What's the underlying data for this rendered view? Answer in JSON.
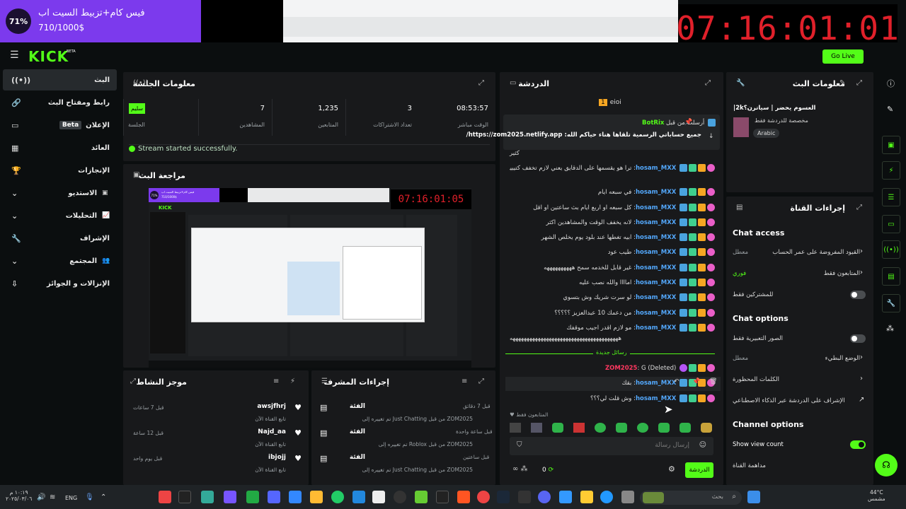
{
  "overlay": {
    "percent": "71%",
    "title": "فيس كام+تزبيط السيت اب",
    "progress": "710/1000$",
    "progress_fraction": 0.71
  },
  "clock": "07:16:01:01",
  "header": {
    "logo": "KICK",
    "logo_badge": "BETA",
    "go_live": "Go Live"
  },
  "sidebar": {
    "items": [
      {
        "label": "البث",
        "active": true
      },
      {
        "label": "رابط ومفتاح البث"
      },
      {
        "label": "الإعلان",
        "badge": "Beta"
      },
      {
        "label": "العائد"
      },
      {
        "label": "الإنجازات"
      },
      {
        "label": "الاستديو"
      },
      {
        "label": "التحليلات"
      },
      {
        "label": "الإشراف"
      },
      {
        "label": "المجتمع"
      },
      {
        "label": "الإنزالات و الجوائز"
      }
    ]
  },
  "session": {
    "title": "معلومات الجلسة",
    "stats": [
      {
        "value": "08:53:57",
        "label": "الوقت مباشر"
      },
      {
        "value": "3",
        "label": "تعداد الاشتراكات"
      },
      {
        "value": "1,235",
        "label": "المتابعين"
      },
      {
        "value": "7",
        "label": "المشاهدين"
      }
    ],
    "health_badge": "سليم",
    "health_label": "الجلسة",
    "status": "Stream started successfully."
  },
  "preview": {
    "title": "مراجعة البث",
    "clock": "07:16:01:05",
    "overlay_pct": "71%",
    "overlay_title": "فيس كام+تزبيط السيت اب",
    "overlay_progress": "710/1000$"
  },
  "activity": {
    "title": "موجز النشاط",
    "items": [
      {
        "name": "awsjfhrj",
        "desc": "تابع القناة الآن",
        "time": "قبل 7 ساعات"
      },
      {
        "name": "Najd_aa",
        "desc": "تابع القناة الآن",
        "time": "قبل 12 ساعة"
      },
      {
        "name": "ibjojj",
        "desc": "تابع القناة الآن",
        "time": "قبل يوم واحد"
      }
    ]
  },
  "mod": {
    "title": "إجراءات المشرف",
    "items": [
      {
        "name": "الفئة",
        "desc": "تم تغييره إلى Just Chatting من قبل ZOM2025",
        "time": "قبل 7 دقائق"
      },
      {
        "name": "الفئة",
        "desc": "تم تغييره إلى Roblox من قبل ZOM2025",
        "time": "قبل ساعة واحدة"
      },
      {
        "name": "الفئة",
        "desc": "تم تغييره إلى Just Chatting من قبل ZOM2025",
        "time": "قبل ساعتين"
      }
    ]
  },
  "chat": {
    "title": "الدردشة",
    "top_user": "eioi",
    "top_rank": "1",
    "pinned_by": "أرسلت من قبل",
    "pinned_user": "BotRix",
    "pinned_text": "جميع حساباتي الرسمية تلقاها هناء حياكم الله: https://zom2025.netlify.app/",
    "partial": "كثير",
    "messages": [
      {
        "user": "hosam_MXX",
        "text": "ترا هو يقسمها على الدقايق يعني لازم تخفف كتيييير الساعات"
      },
      {
        "user": "hosam_MXX",
        "text": "في سبعه ايام"
      },
      {
        "user": "hosam_MXX",
        "text": "كل سبعه او اربع ايام بث ساعتين او اقل"
      },
      {
        "user": "hosam_MXX",
        "text": "لانه يخفف الوقت والمشاهدين اكثر"
      },
      {
        "user": "hosam_MXX",
        "text": "ابيه تغطها عند بلود يوم يخلص الشهر"
      },
      {
        "user": "hosam_MXX",
        "text": "طيب عود"
      },
      {
        "user": "hosam_MXX",
        "text": "غير قابل للخدمه سمح ههههههههههه"
      },
      {
        "user": "hosam_MXX",
        "text": "اماااا والله نصب عليه"
      },
      {
        "user": "hosam_MXX",
        "text": "لو سرت شريك وش بتسوي"
      },
      {
        "user": "hosam_MXX",
        "text": "من دعمك 10 عبدالعزيز ؟؟؟؟؟"
      },
      {
        "user": "hosam_MXX",
        "text": "مو لازم اقدر اجيب موقفك"
      },
      {
        "user": "",
        "text": "هههههههههههههههههههههههههههههههههههههههه"
      }
    ],
    "new_messages": "رسائل جديدة",
    "deleted": {
      "user": "ZOM2025",
      "text": "G (Deleted)"
    },
    "after": [
      {
        "user": "hosam_MXX",
        "text": "بقك"
      },
      {
        "user": "hosam_MXX",
        "text": "وش قلت لي؟؟؟"
      }
    ],
    "followers_only": "المتابعون فقط",
    "input_placeholder": "إرسال رسالة",
    "count": "0",
    "send": "الدردشة"
  },
  "stream_info": {
    "title": "معلومات البث",
    "stream_title": "العسوم يحضر | سياترن؟2k|",
    "subtitle": "مخصصة للدردشة فقط",
    "language": "Arabic"
  },
  "channel": {
    "title": "إجراءات القناة",
    "chat_access": "Chat access",
    "rows1": [
      {
        "label": "القيود المفروضة على عمر الحساب",
        "value": "معطل",
        "kind": "chevron"
      },
      {
        "label": "المتابعون فقط",
        "value": "فوري",
        "kind": "chevron"
      },
      {
        "label": "للمشتركين فقط",
        "kind": "toggle",
        "on": false
      }
    ],
    "chat_options": "Chat options",
    "rows2": [
      {
        "label": "الصور التعبيرية فقط",
        "kind": "toggle",
        "on": false
      },
      {
        "label": "الوضع البطيء",
        "value": "معطل",
        "kind": "chevron"
      },
      {
        "label": "الكلمات المحظورة",
        "kind": "chevron"
      },
      {
        "label": "الإشراف على الدردشة عبر الذكاء الاصطناعي",
        "kind": "link"
      }
    ],
    "channel_options": "Channel options",
    "show_view_count": "Show view count",
    "view_count_on": true,
    "host": "مداهمة القناة"
  },
  "taskbar": {
    "time": "١٠:١٩ م",
    "date": "٢٠٢٥/٠٣/٠٦",
    "lang": "ENG",
    "search": "بحث",
    "temp": "44°C",
    "weather": "مشمس"
  },
  "colors": {
    "accent": "#53fc18",
    "overlay": "#7c3aed",
    "clock": "#e0202a",
    "username": "#53a8fc",
    "deleted_user": "#ff3860"
  }
}
